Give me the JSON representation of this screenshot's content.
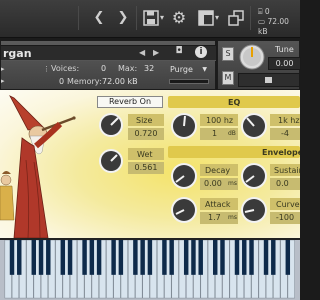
{
  "toolbar": {
    "buttons": [
      {
        "icon": "chevron-left-icon",
        "glyph": "❮"
      },
      {
        "icon": "chevron-right-icon",
        "glyph": "❯"
      },
      {
        "icon": "save-icon",
        "glyph": "▼"
      },
      {
        "icon": "gear-icon",
        "glyph": "⚙"
      },
      {
        "icon": "layout-icon",
        "glyph": "▦"
      },
      {
        "icon": "resize-icon",
        "glyph": "⤢"
      }
    ],
    "cpu": "0",
    "memory": "72.00 kB"
  },
  "instrument": {
    "name": "rgan",
    "voices_label": "Voices:",
    "voices_value": "0",
    "max_label": "Max:",
    "max_value": "32",
    "memory_label": "Memory:",
    "memory_value": "72.00 kB",
    "purge_label": "Purge",
    "zero_label": "0"
  },
  "side": {
    "solo_label": "S",
    "mute_label": "M",
    "tune_label": "Tune",
    "tune_value": "0.00"
  },
  "reverb": {
    "on_label": "Reverb On",
    "size_label": "Size",
    "size_value": "0.720",
    "wet_label": "Wet",
    "wet_value": "0.561"
  },
  "eq": {
    "title": "EQ",
    "band1_label": "100 hz",
    "band1_value": "1",
    "band1_unit": "dB",
    "band2_label": "1k hz",
    "band2_value": "-4"
  },
  "envelope": {
    "title": "Envelope",
    "decay_label": "Decay",
    "decay_value": "0.00",
    "decay_unit": "ms",
    "sustain_label": "Sustain",
    "sustain_value": "0.0",
    "attack_label": "Attack",
    "attack_value": "1.7",
    "attack_unit": "ms",
    "curve_label": "Curve",
    "curve_value": "-100"
  },
  "colors": {
    "panel_yellow": "#f4e36a",
    "section_bar": "#e0c94c",
    "knob_body": "#3a3a3a"
  }
}
